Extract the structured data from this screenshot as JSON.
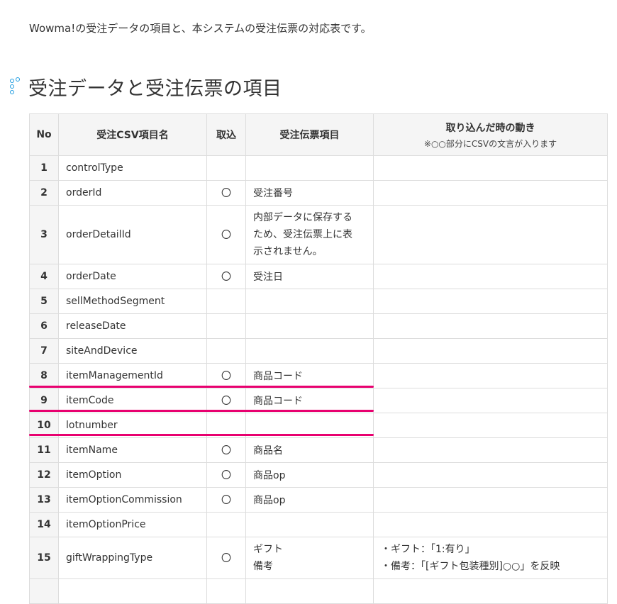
{
  "intro_text": "Wowma!の受注データの項目と、本システムの受注伝票の対応表です。",
  "section_title": "受注データと受注伝票の項目",
  "table": {
    "headers": {
      "no": "No",
      "csv_item": "受注CSV項目名",
      "import": "取込",
      "slip_item": "受注伝票項目",
      "behavior": "取り込んだ時の動き",
      "behavior_note": "※○○部分にCSVの文言が入ります"
    },
    "rows": [
      {
        "no": "1",
        "csv": "controlType",
        "flag": "",
        "slip": [],
        "note": []
      },
      {
        "no": "2",
        "csv": "orderId",
        "flag": "〇",
        "slip": [
          "受注番号"
        ],
        "note": []
      },
      {
        "no": "3",
        "csv": "orderDetailId",
        "flag": "〇",
        "slip": [
          "内部データに保存する",
          "ため、受注伝票上に表",
          "示されません。"
        ],
        "note": []
      },
      {
        "no": "4",
        "csv": "orderDate",
        "flag": "〇",
        "slip": [
          "受注日"
        ],
        "note": []
      },
      {
        "no": "5",
        "csv": "sellMethodSegment",
        "flag": "",
        "slip": [],
        "note": []
      },
      {
        "no": "6",
        "csv": "releaseDate",
        "flag": "",
        "slip": [],
        "note": []
      },
      {
        "no": "7",
        "csv": "siteAndDevice",
        "flag": "",
        "slip": [],
        "note": []
      },
      {
        "no": "8",
        "csv": "itemManagementId",
        "flag": "〇",
        "slip": [
          "商品コード"
        ],
        "note": []
      },
      {
        "no": "9",
        "csv": "itemCode",
        "flag": "〇",
        "slip": [
          "商品コード"
        ],
        "note": []
      },
      {
        "no": "10",
        "csv": "lotnumber",
        "flag": "",
        "slip": [],
        "note": []
      },
      {
        "no": "11",
        "csv": "itemName",
        "flag": "〇",
        "slip": [
          "商品名"
        ],
        "note": []
      },
      {
        "no": "12",
        "csv": "itemOption",
        "flag": "〇",
        "slip": [
          "商品op"
        ],
        "note": []
      },
      {
        "no": "13",
        "csv": "itemOptionCommission",
        "flag": "〇",
        "slip": [
          "商品op"
        ],
        "note": []
      },
      {
        "no": "14",
        "csv": "itemOptionPrice",
        "flag": "",
        "slip": [],
        "note": []
      },
      {
        "no": "15",
        "csv": "giftWrappingType",
        "flag": "〇",
        "slip": [
          "ギフト",
          "備考"
        ],
        "note": [
          "・ギフト：「1:有り」",
          "・備考：「[ギフト包装種別]○○」を反映"
        ]
      },
      {
        "no": "",
        "csv": "",
        "flag": "",
        "slip": [],
        "note": []
      }
    ]
  },
  "colors": {
    "accent_icon": "#1e9be0",
    "highlight_underline": "#e8006f",
    "header_bg": "#f5f5f5",
    "border": "#dddddd"
  },
  "icons": {
    "heading_marker": "dotted-bullet-icon"
  }
}
